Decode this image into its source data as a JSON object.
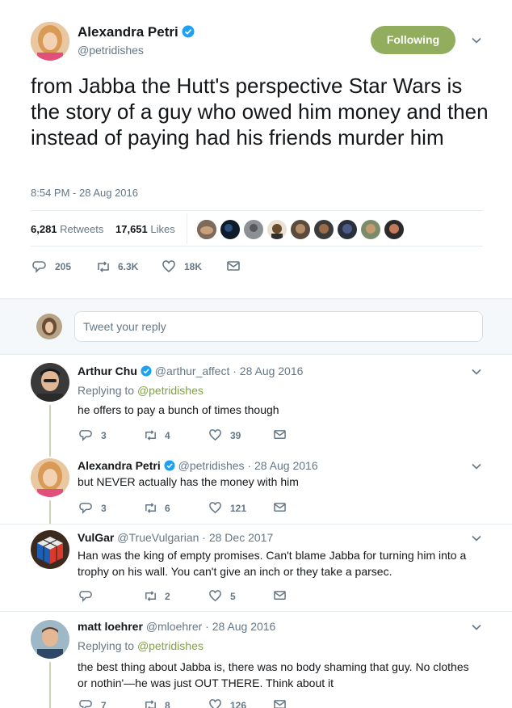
{
  "main_tweet": {
    "author_name": "Alexandra Petri",
    "author_handle": "@petridishes",
    "follow_button": "Following",
    "text": "from Jabba the Hutt's perspective Star Wars is the story of a guy who owed him money and then instead of paying had his friends murder him",
    "timestamp": "8:54 PM - 28 Aug 2016",
    "retweets_count": "6,281",
    "retweets_label": "Retweets",
    "likes_count": "17,651",
    "likes_label": "Likes",
    "replies": "205",
    "retweets_short": "6.3K",
    "likes_short": "18K"
  },
  "reply_box": {
    "placeholder": "Tweet your reply"
  },
  "replies": [
    {
      "name": "Arthur Chu",
      "handle": "@arthur_affect",
      "date": "· 28 Aug 2016",
      "replying_label": "Replying to",
      "replying_to": "@petridishes",
      "text": "he offers to pay a bunch of times though",
      "replies": "3",
      "retweets": "4",
      "likes": "39"
    },
    {
      "name": "Alexandra Petri",
      "handle": "@petridishes",
      "date": "· 28 Aug 2016",
      "text": "but NEVER actually has the money with him",
      "replies": "3",
      "retweets": "6",
      "likes": "121"
    },
    {
      "name": "VulGar",
      "handle": "@TrueVulgarian",
      "date": "· 28 Dec 2017",
      "text_line1": "Han was the king of empty promises. Can't blame Jabba for turning him into a",
      "text_line2": "trophy on his wall. You can't give an inch or they take a parsec.",
      "replies": "",
      "retweets": "2",
      "likes": "5"
    },
    {
      "name": "matt loehrer",
      "handle": "@mloehrer",
      "date": "· 28 Aug 2016",
      "replying_label": "Replying to",
      "replying_to": "@petridishes",
      "text_line1": "the best thing about Jabba is, there was no body shaming that guy. No clothes",
      "text_line2": "or nothin'—he was just OUT THERE. Think about it",
      "replies": "7",
      "retweets": "8",
      "likes": "126"
    }
  ],
  "colors": {
    "accent": "#91ad5d",
    "link": "#7fa33f",
    "verified": "#1da1f2"
  }
}
